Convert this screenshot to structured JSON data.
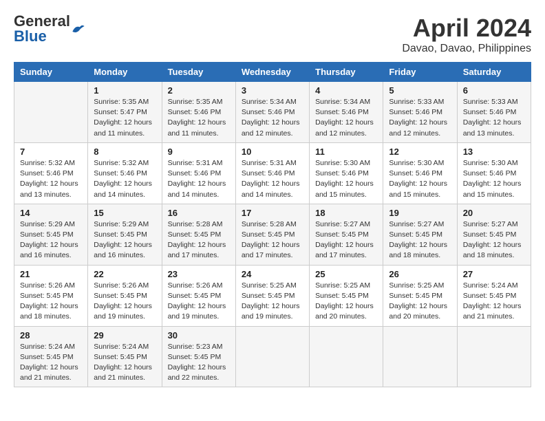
{
  "header": {
    "logo_general": "General",
    "logo_blue": "Blue",
    "month": "April 2024",
    "location": "Davao, Davao, Philippines"
  },
  "columns": [
    "Sunday",
    "Monday",
    "Tuesday",
    "Wednesday",
    "Thursday",
    "Friday",
    "Saturday"
  ],
  "weeks": [
    [
      {
        "num": "",
        "info": ""
      },
      {
        "num": "1",
        "info": "Sunrise: 5:35 AM\nSunset: 5:47 PM\nDaylight: 12 hours\nand 11 minutes."
      },
      {
        "num": "2",
        "info": "Sunrise: 5:35 AM\nSunset: 5:46 PM\nDaylight: 12 hours\nand 11 minutes."
      },
      {
        "num": "3",
        "info": "Sunrise: 5:34 AM\nSunset: 5:46 PM\nDaylight: 12 hours\nand 12 minutes."
      },
      {
        "num": "4",
        "info": "Sunrise: 5:34 AM\nSunset: 5:46 PM\nDaylight: 12 hours\nand 12 minutes."
      },
      {
        "num": "5",
        "info": "Sunrise: 5:33 AM\nSunset: 5:46 PM\nDaylight: 12 hours\nand 12 minutes."
      },
      {
        "num": "6",
        "info": "Sunrise: 5:33 AM\nSunset: 5:46 PM\nDaylight: 12 hours\nand 13 minutes."
      }
    ],
    [
      {
        "num": "7",
        "info": "Sunrise: 5:32 AM\nSunset: 5:46 PM\nDaylight: 12 hours\nand 13 minutes."
      },
      {
        "num": "8",
        "info": "Sunrise: 5:32 AM\nSunset: 5:46 PM\nDaylight: 12 hours\nand 14 minutes."
      },
      {
        "num": "9",
        "info": "Sunrise: 5:31 AM\nSunset: 5:46 PM\nDaylight: 12 hours\nand 14 minutes."
      },
      {
        "num": "10",
        "info": "Sunrise: 5:31 AM\nSunset: 5:46 PM\nDaylight: 12 hours\nand 14 minutes."
      },
      {
        "num": "11",
        "info": "Sunrise: 5:30 AM\nSunset: 5:46 PM\nDaylight: 12 hours\nand 15 minutes."
      },
      {
        "num": "12",
        "info": "Sunrise: 5:30 AM\nSunset: 5:46 PM\nDaylight: 12 hours\nand 15 minutes."
      },
      {
        "num": "13",
        "info": "Sunrise: 5:30 AM\nSunset: 5:46 PM\nDaylight: 12 hours\nand 15 minutes."
      }
    ],
    [
      {
        "num": "14",
        "info": "Sunrise: 5:29 AM\nSunset: 5:45 PM\nDaylight: 12 hours\nand 16 minutes."
      },
      {
        "num": "15",
        "info": "Sunrise: 5:29 AM\nSunset: 5:45 PM\nDaylight: 12 hours\nand 16 minutes."
      },
      {
        "num": "16",
        "info": "Sunrise: 5:28 AM\nSunset: 5:45 PM\nDaylight: 12 hours\nand 17 minutes."
      },
      {
        "num": "17",
        "info": "Sunrise: 5:28 AM\nSunset: 5:45 PM\nDaylight: 12 hours\nand 17 minutes."
      },
      {
        "num": "18",
        "info": "Sunrise: 5:27 AM\nSunset: 5:45 PM\nDaylight: 12 hours\nand 17 minutes."
      },
      {
        "num": "19",
        "info": "Sunrise: 5:27 AM\nSunset: 5:45 PM\nDaylight: 12 hours\nand 18 minutes."
      },
      {
        "num": "20",
        "info": "Sunrise: 5:27 AM\nSunset: 5:45 PM\nDaylight: 12 hours\nand 18 minutes."
      }
    ],
    [
      {
        "num": "21",
        "info": "Sunrise: 5:26 AM\nSunset: 5:45 PM\nDaylight: 12 hours\nand 18 minutes."
      },
      {
        "num": "22",
        "info": "Sunrise: 5:26 AM\nSunset: 5:45 PM\nDaylight: 12 hours\nand 19 minutes."
      },
      {
        "num": "23",
        "info": "Sunrise: 5:26 AM\nSunset: 5:45 PM\nDaylight: 12 hours\nand 19 minutes."
      },
      {
        "num": "24",
        "info": "Sunrise: 5:25 AM\nSunset: 5:45 PM\nDaylight: 12 hours\nand 19 minutes."
      },
      {
        "num": "25",
        "info": "Sunrise: 5:25 AM\nSunset: 5:45 PM\nDaylight: 12 hours\nand 20 minutes."
      },
      {
        "num": "26",
        "info": "Sunrise: 5:25 AM\nSunset: 5:45 PM\nDaylight: 12 hours\nand 20 minutes."
      },
      {
        "num": "27",
        "info": "Sunrise: 5:24 AM\nSunset: 5:45 PM\nDaylight: 12 hours\nand 21 minutes."
      }
    ],
    [
      {
        "num": "28",
        "info": "Sunrise: 5:24 AM\nSunset: 5:45 PM\nDaylight: 12 hours\nand 21 minutes."
      },
      {
        "num": "29",
        "info": "Sunrise: 5:24 AM\nSunset: 5:45 PM\nDaylight: 12 hours\nand 21 minutes."
      },
      {
        "num": "30",
        "info": "Sunrise: 5:23 AM\nSunset: 5:45 PM\nDaylight: 12 hours\nand 22 minutes."
      },
      {
        "num": "",
        "info": ""
      },
      {
        "num": "",
        "info": ""
      },
      {
        "num": "",
        "info": ""
      },
      {
        "num": "",
        "info": ""
      }
    ]
  ]
}
